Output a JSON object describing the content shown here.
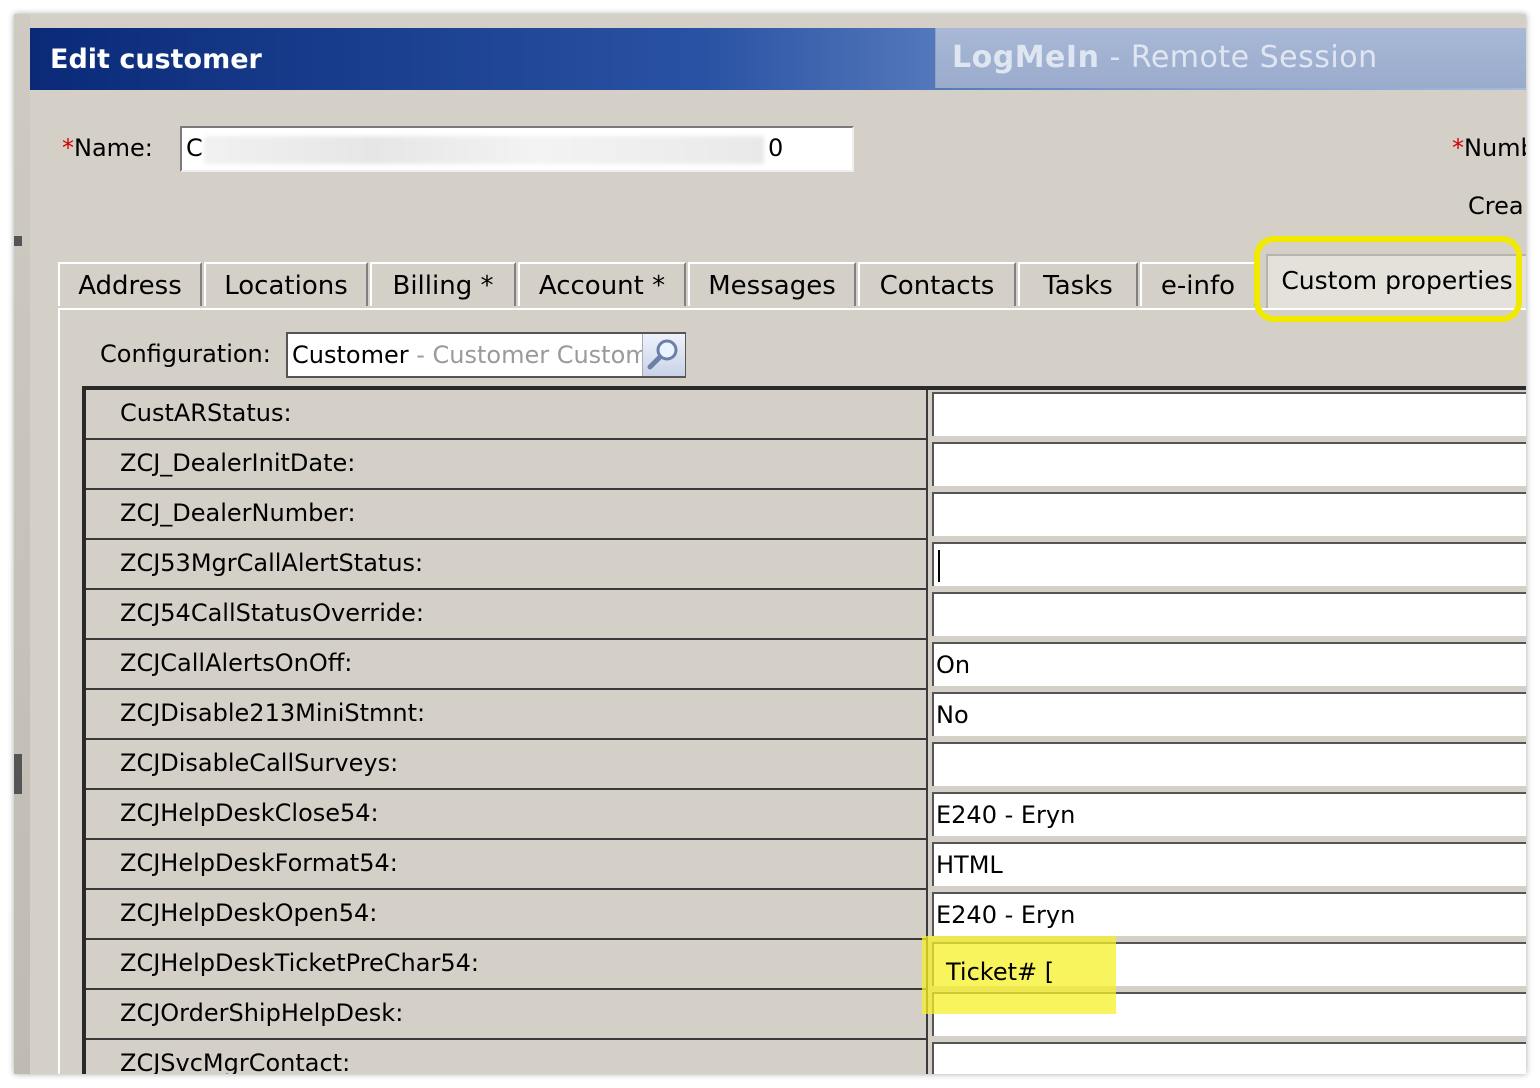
{
  "window": {
    "title": "Edit customer",
    "overlay_brand": "LogMeIn",
    "overlay_separator": " - ",
    "overlay_suffix": "Remote Session"
  },
  "form": {
    "required_mark": "*",
    "name_label": "Name:",
    "name_value_start": "C",
    "name_value_end": "0",
    "number_label": "Numb",
    "created_label": "Crea"
  },
  "tabs": [
    {
      "label": "Address"
    },
    {
      "label": "Locations"
    },
    {
      "label": "Billing *"
    },
    {
      "label": "Account *"
    },
    {
      "label": "Messages"
    },
    {
      "label": "Contacts"
    },
    {
      "label": "Tasks"
    },
    {
      "label": "e-info"
    },
    {
      "label": "Custom properties",
      "active": true
    }
  ],
  "configuration": {
    "label": "Configuration:",
    "value_main": "Customer",
    "value_sep": " - ",
    "value_sub": "Customer Custom"
  },
  "properties": [
    {
      "name": "CustARStatus:",
      "value": ""
    },
    {
      "name": "ZCJ_DealerInitDate:",
      "value": ""
    },
    {
      "name": "ZCJ_DealerNumber:",
      "value": ""
    },
    {
      "name": "ZCJ53MgrCallAlertStatus:",
      "value": ""
    },
    {
      "name": "ZCJ54CallStatusOverride:",
      "value": ""
    },
    {
      "name": "ZCJCallAlertsOnOff:",
      "value": "On"
    },
    {
      "name": "ZCJDisable213MiniStmnt:",
      "value": "No"
    },
    {
      "name": "ZCJDisableCallSurveys:",
      "value": ""
    },
    {
      "name": "ZCJHelpDeskClose54:",
      "value": "E240 - Eryn"
    },
    {
      "name": "ZCJHelpDeskFormat54:",
      "value": "HTML"
    },
    {
      "name": "ZCJHelpDeskOpen54:",
      "value": "E240 - Eryn"
    },
    {
      "name": "ZCJHelpDeskTicketPreChar54:",
      "value": "Ticket# ["
    },
    {
      "name": "ZCJOrderShipHelpDesk:",
      "value": ""
    },
    {
      "name": "ZCJSvcMgrContact:",
      "value": ""
    }
  ],
  "colors": {
    "highlight": "#f2e900",
    "title_bar": "#0a2a78",
    "required": "#d00000"
  },
  "icons": {
    "lookup": "magnifier-icon"
  }
}
